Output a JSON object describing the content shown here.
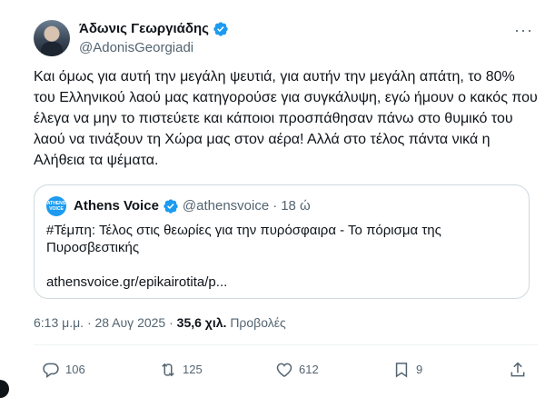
{
  "author": {
    "display_name": "Άδωνις Γεωργιάδης",
    "handle": "@AdonisGeorgiadi"
  },
  "menu_glyph": "···",
  "body": "Και όμως για αυτή την μεγάλη ψευτιά, για αυτήν την μεγάλη απάτη, το 80% του Ελληνικού λαού μας κατηγορούσε για συγκάλυψη, εγώ ήμουν ο κακός που έλεγα να μην το πιστεύετε και κάποιοι προσπάθησαν πάνω στο θυμικό του λαού να τινάξουν τη Χώρα μας στον αέρα! Αλλά στο τέλος πάντα νικά η Αλήθεια τα ψέματα.",
  "quote": {
    "avatar_text_1": "ATHENS",
    "avatar_text_2": "VOICE",
    "name": "Athens Voice",
    "handle": "@athensvoice",
    "separator": "·",
    "time": "18 ώ",
    "text": "#Τέμπη: Τέλος στις θεωρίες για την πυρόσφαιρα - Το πόρισμα της Πυροσβεστικής",
    "link": "athensvoice.gr/epikairotita/p..."
  },
  "meta": {
    "time_date": "6:13 μ.μ. · 28 Αυγ 2025 ·",
    "views_count": "35,6 χιλ.",
    "views_label": "Προβολές"
  },
  "actions": {
    "replies": "106",
    "retweets": "125",
    "likes": "612",
    "bookmarks": "9"
  },
  "colors": {
    "verified_blue": "#1d9bf0",
    "secondary_text": "#536471",
    "primary_text": "#0f1419",
    "border": "#cfd9de"
  },
  "icons": [
    "verified-badge-icon",
    "more-icon",
    "reply-icon",
    "retweet-icon",
    "like-icon",
    "bookmark-icon",
    "share-icon"
  ]
}
